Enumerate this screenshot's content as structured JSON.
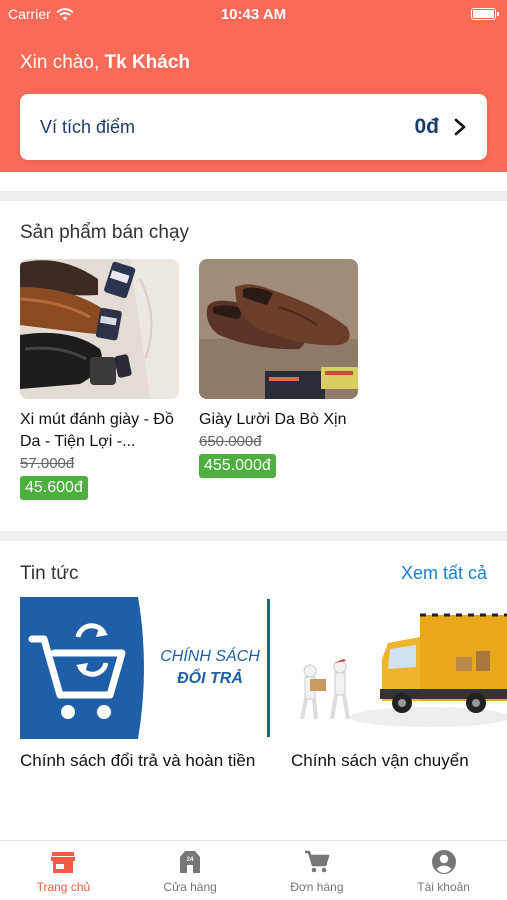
{
  "status_bar": {
    "carrier": "Carrier",
    "time": "10:43 AM"
  },
  "greeting": {
    "prefix": "Xin chào, ",
    "name": "Tk Khách"
  },
  "wallet": {
    "label": "Ví tích điểm",
    "value": "0đ"
  },
  "best_sellers": {
    "title": "Sản phẩm bán chạy",
    "items": [
      {
        "name": "Xi mút đánh giày - Đồ Da - Tiện Lợi -...",
        "old_price": "57.000đ",
        "price": "45.600đ"
      },
      {
        "name": "Giày Lười Da Bò Xịn",
        "old_price": "650.000đ",
        "price": "455.000đ"
      }
    ]
  },
  "news": {
    "title": "Tin tức",
    "see_all": "Xem tất cả",
    "items": [
      {
        "title": "Chính sách đổi trả và hoàn tiền",
        "banner_line1": "CHÍNH SÁCH",
        "banner_line2": "ĐỔI TRẢ"
      },
      {
        "title": "Chính sách vận chuyển"
      }
    ]
  },
  "tabbar": [
    {
      "label": "Trang chủ",
      "icon": "store-icon",
      "active": true
    },
    {
      "label": "Cửa hàng",
      "icon": "shop-24-icon",
      "active": false
    },
    {
      "label": "Đơn hàng",
      "icon": "cart-icon",
      "active": false
    },
    {
      "label": "Tài khoản",
      "icon": "account-icon",
      "active": false
    }
  ],
  "colors": {
    "header": "#fa6a58",
    "accent": "#f25c46",
    "price_badge": "#4caf3e",
    "link": "#1a7fd6",
    "wallet_text": "#1d3c6e"
  }
}
